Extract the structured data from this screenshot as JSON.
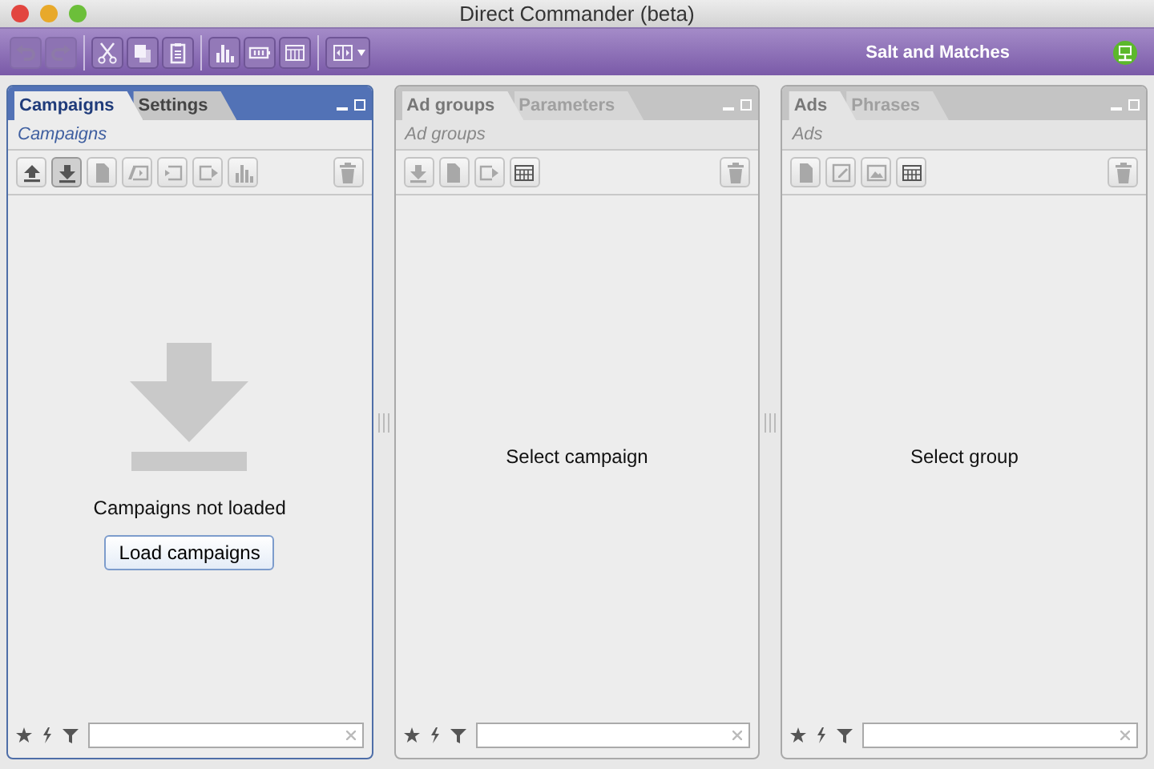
{
  "window": {
    "title": "Direct Commander (beta)"
  },
  "toolbar": {
    "buttons": [
      {
        "kind": "undo",
        "disabled": true
      },
      {
        "kind": "redo",
        "disabled": true
      },
      {
        "kind": "cut",
        "disabled": false
      },
      {
        "kind": "copy",
        "disabled": false
      },
      {
        "kind": "paste",
        "disabled": false
      },
      {
        "kind": "chart",
        "disabled": false
      },
      {
        "kind": "battery",
        "disabled": false
      },
      {
        "kind": "columns",
        "disabled": false
      },
      {
        "kind": "layout",
        "disabled": false
      }
    ],
    "account": "Salt and Matches"
  },
  "panels": [
    {
      "active": true,
      "tabs": [
        {
          "label": "Campaigns",
          "selected": true
        },
        {
          "label": "Settings",
          "selected": false
        }
      ],
      "subtitle": "Campaigns",
      "tools": [
        {
          "kind": "upload",
          "pressed": false,
          "disabled": false
        },
        {
          "kind": "download",
          "pressed": true,
          "disabled": false
        },
        {
          "kind": "doc",
          "pressed": false,
          "disabled": true
        },
        {
          "kind": "rename",
          "pressed": false,
          "disabled": true
        },
        {
          "kind": "import",
          "pressed": false,
          "disabled": true
        },
        {
          "kind": "export",
          "pressed": false,
          "disabled": true
        },
        {
          "kind": "chart",
          "pressed": false,
          "disabled": true
        }
      ],
      "body": {
        "kind": "not_loaded",
        "message": "Campaigns not loaded",
        "button": "Load campaigns"
      }
    },
    {
      "active": false,
      "tabs": [
        {
          "label": "Ad groups",
          "selected": true
        },
        {
          "label": "Parameters",
          "selected": false
        }
      ],
      "subtitle": "Ad groups",
      "tools": [
        {
          "kind": "download",
          "pressed": false,
          "disabled": true
        },
        {
          "kind": "doc",
          "pressed": false,
          "disabled": true
        },
        {
          "kind": "export",
          "pressed": false,
          "disabled": true
        },
        {
          "kind": "table",
          "pressed": false,
          "disabled": false
        }
      ],
      "body": {
        "kind": "message",
        "message": "Select campaign"
      }
    },
    {
      "active": false,
      "tabs": [
        {
          "label": "Ads",
          "selected": true
        },
        {
          "label": "Phrases",
          "selected": false
        }
      ],
      "subtitle": "Ads",
      "tools": [
        {
          "kind": "doc",
          "pressed": false,
          "disabled": true
        },
        {
          "kind": "edit",
          "pressed": false,
          "disabled": true
        },
        {
          "kind": "image",
          "pressed": false,
          "disabled": true
        },
        {
          "kind": "table",
          "pressed": false,
          "disabled": false
        }
      ],
      "body": {
        "kind": "message",
        "message": "Select group"
      }
    }
  ]
}
